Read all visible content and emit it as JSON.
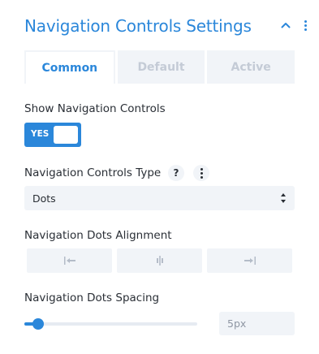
{
  "header": {
    "title": "Navigation Controls Settings",
    "collapse_icon": "chevron-up-icon",
    "menu_icon": "kebab-menu-icon"
  },
  "tabs": [
    {
      "label": "Common",
      "active": true
    },
    {
      "label": "Default",
      "active": false
    },
    {
      "label": "Active",
      "active": false
    }
  ],
  "show_navigation": {
    "label": "Show Navigation Controls",
    "toggle_text": "YES",
    "enabled": true
  },
  "controls_type": {
    "label": "Navigation Controls Type",
    "help_symbol": "?",
    "selected": "Dots"
  },
  "dots_alignment": {
    "label": "Navigation Dots Alignment",
    "options": [
      {
        "icon": "align-left-icon"
      },
      {
        "icon": "align-center-icon"
      },
      {
        "icon": "align-right-icon"
      }
    ]
  },
  "dots_spacing": {
    "label": "Navigation Dots Spacing",
    "value": "5px",
    "fraction": 0.08
  },
  "colors": {
    "accent": "#2b87da",
    "control_bg": "#f1f4f8",
    "muted_text": "#c4cbd6"
  }
}
